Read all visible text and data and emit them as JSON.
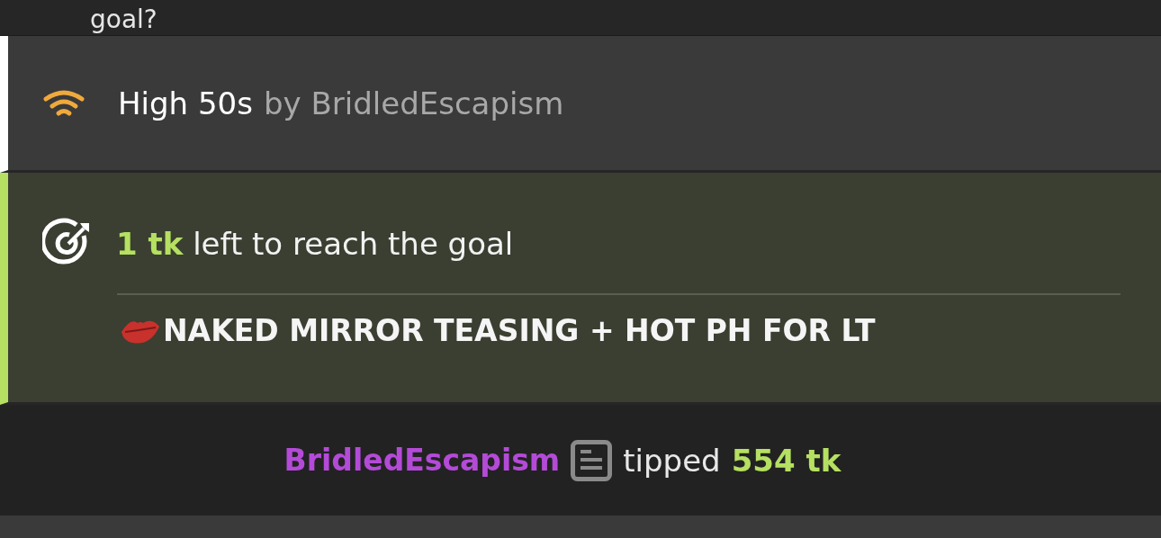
{
  "messages": [
    {
      "kind": "text",
      "text": "goal?"
    },
    {
      "kind": "song",
      "title": "High 50s",
      "credit": "by BridledEscapism"
    },
    {
      "kind": "goal",
      "status": "**1 tk** left to reach the goal",
      "goal_title": "NAKED MIRROR TEASING + HOT PH FOR LT"
    },
    {
      "kind": "tip",
      "user": "BridledEscapism",
      "action": "tipped",
      "amount": "554 tk"
    },
    {
      "kind": "empty"
    }
  ]
}
